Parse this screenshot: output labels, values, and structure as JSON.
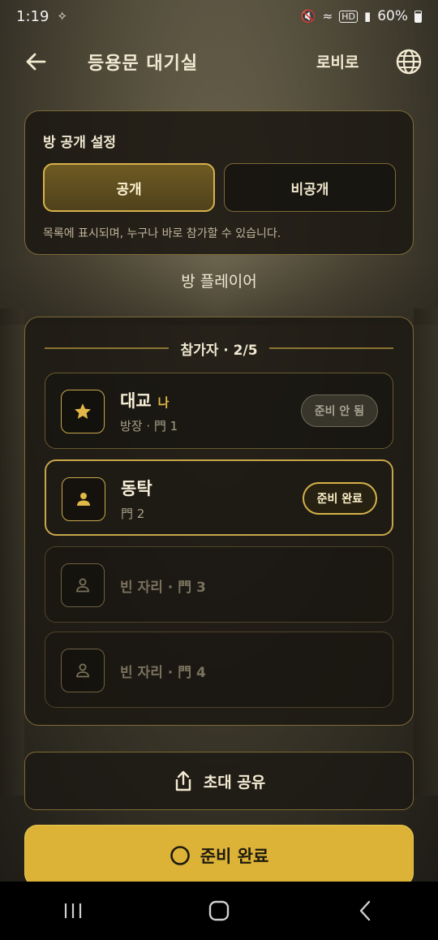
{
  "status_bar": {
    "time": "1:19",
    "battery": "60%"
  },
  "header": {
    "title": "등용문 대기실",
    "lobby_label": "로비로"
  },
  "visibility": {
    "title": "방 공개 설정",
    "public_label": "공개",
    "private_label": "비공개",
    "selected": "공개",
    "description": "목록에 표시되며, 누구나 바로 참가할 수 있습니다."
  },
  "section_label": "방 플레이어",
  "participants": {
    "count_label": "참가자 · 2/5",
    "seats": [
      {
        "name": "대교",
        "me_badge": "나",
        "sub": "방장 · 門 1",
        "status": "준비 안 됨",
        "icon": "star-icon"
      },
      {
        "name": "동탁",
        "sub": "門 2",
        "status": "준비 완료",
        "icon": "person-icon"
      },
      {
        "label": "빈 자리 · 門 3",
        "icon": "person-outline-icon"
      },
      {
        "label": "빈 자리 · 門 4",
        "icon": "person-outline-icon"
      }
    ]
  },
  "share_label": "초대 공유",
  "ready_label": "준비 완료",
  "colors": {
    "accent_gold": "#dcb336",
    "border_gold": "#7d6a36",
    "panel": "#1c1913"
  }
}
